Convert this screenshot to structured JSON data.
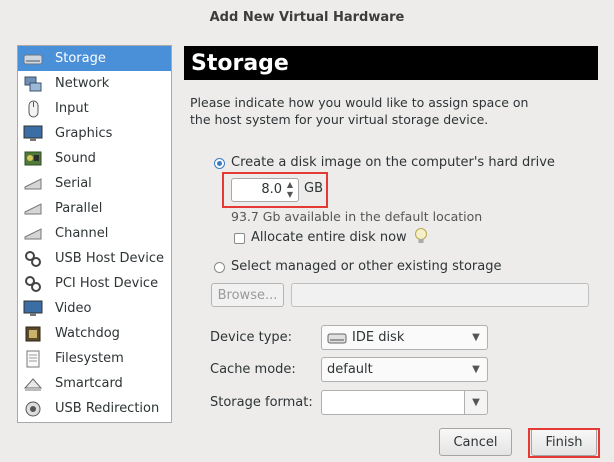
{
  "window": {
    "title": "Add New Virtual Hardware"
  },
  "sidebar": {
    "items": [
      {
        "label": "Storage",
        "icon": "storage-icon",
        "selected": true
      },
      {
        "label": "Network",
        "icon": "network-icon"
      },
      {
        "label": "Input",
        "icon": "mouse-icon"
      },
      {
        "label": "Graphics",
        "icon": "monitor-icon"
      },
      {
        "label": "Sound",
        "icon": "sound-card-icon"
      },
      {
        "label": "Serial",
        "icon": "serial-port-icon"
      },
      {
        "label": "Parallel",
        "icon": "parallel-port-icon"
      },
      {
        "label": "Channel",
        "icon": "channel-icon"
      },
      {
        "label": "USB Host Device",
        "icon": "usb-icon"
      },
      {
        "label": "PCI Host Device",
        "icon": "pci-icon"
      },
      {
        "label": "Video",
        "icon": "video-icon"
      },
      {
        "label": "Watchdog",
        "icon": "watchdog-icon"
      },
      {
        "label": "Filesystem",
        "icon": "folder-icon"
      },
      {
        "label": "Smartcard",
        "icon": "smartcard-icon"
      },
      {
        "label": "USB Redirection",
        "icon": "usb-redirection-icon"
      }
    ]
  },
  "main": {
    "header": "Storage",
    "description": "Please indicate how you would like to assign space on the host system for your virtual storage device.",
    "option_create": {
      "label": "Create a disk image on the computer's hard drive",
      "selected": true
    },
    "size": {
      "value": "8.0",
      "unit": "GB"
    },
    "available": "93.7 Gb available in the default location",
    "allocate": {
      "label": "Allocate entire disk now",
      "checked": false
    },
    "option_existing": {
      "label": "Select managed or other existing storage",
      "selected": false
    },
    "browse_label": "Browse...",
    "browse_path": "",
    "device_type": {
      "label": "Device type:",
      "value": "IDE disk"
    },
    "cache_mode": {
      "label": "Cache mode:",
      "value": "default"
    },
    "storage_format": {
      "label": "Storage format:",
      "value": ""
    }
  },
  "buttons": {
    "cancel": "Cancel",
    "finish": "Finish"
  },
  "colors": {
    "selection": "#4a90d9",
    "header_bg": "#000000",
    "highlight": "#e53935"
  }
}
